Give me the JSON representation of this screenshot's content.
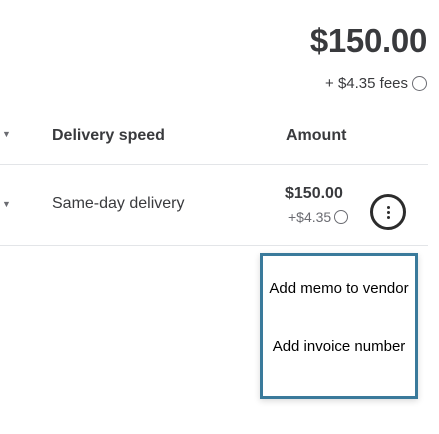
{
  "summary": {
    "total": "$150.00",
    "fees_label": "+ $4.35 fees"
  },
  "table": {
    "headers": [
      "Delivery speed",
      "Amount"
    ],
    "rows": [
      {
        "speed": "Same-day delivery",
        "amount": "$150.00",
        "fee": "+$4.35"
      }
    ]
  },
  "menu": {
    "items": [
      "Add memo to vendor",
      "Add invoice number"
    ]
  },
  "icons": {
    "info": "info-circle-icon",
    "expand": "chevron-down-icon",
    "more": "more-vertical-icon"
  }
}
